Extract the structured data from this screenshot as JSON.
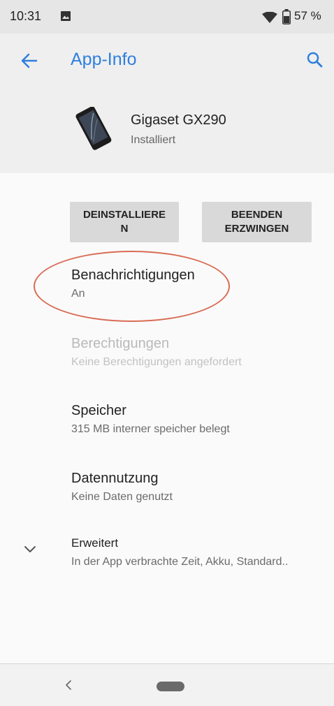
{
  "status_bar": {
    "time": "10:31",
    "battery": "57 %",
    "icons": [
      "image-icon",
      "wifi-icon",
      "battery-icon"
    ]
  },
  "header": {
    "title": "App-Info",
    "back_icon": "arrow-left-icon",
    "search_icon": "search-icon"
  },
  "app": {
    "name": "Gigaset GX290",
    "status": "Installiert",
    "icon": "phone-icon"
  },
  "buttons": {
    "uninstall_line1": "DEINSTALLIERE",
    "uninstall_line2": "N",
    "force_stop_line1": "BEENDEN",
    "force_stop_line2": "ERZWINGEN"
  },
  "items": [
    {
      "title": "Benachrichtigungen",
      "subtitle": "An",
      "enabled": true
    },
    {
      "title": "Berechtigungen",
      "subtitle": "Keine Berechtigungen angefordert",
      "enabled": false
    },
    {
      "title": "Speicher",
      "subtitle": "315 MB interner speicher belegt",
      "enabled": true
    },
    {
      "title": "Datennutzung",
      "subtitle": "Keine Daten genutzt",
      "enabled": true
    },
    {
      "title": "Erweitert",
      "subtitle": "In der App verbrachte Zeit, Akku, Standard..",
      "enabled": true
    }
  ],
  "colors": {
    "accent": "#2f7fde",
    "highlight_circle": "#d96c55"
  },
  "nav": {
    "back_icon": "chevron-left-icon",
    "home_icon": "home-pill-icon"
  }
}
